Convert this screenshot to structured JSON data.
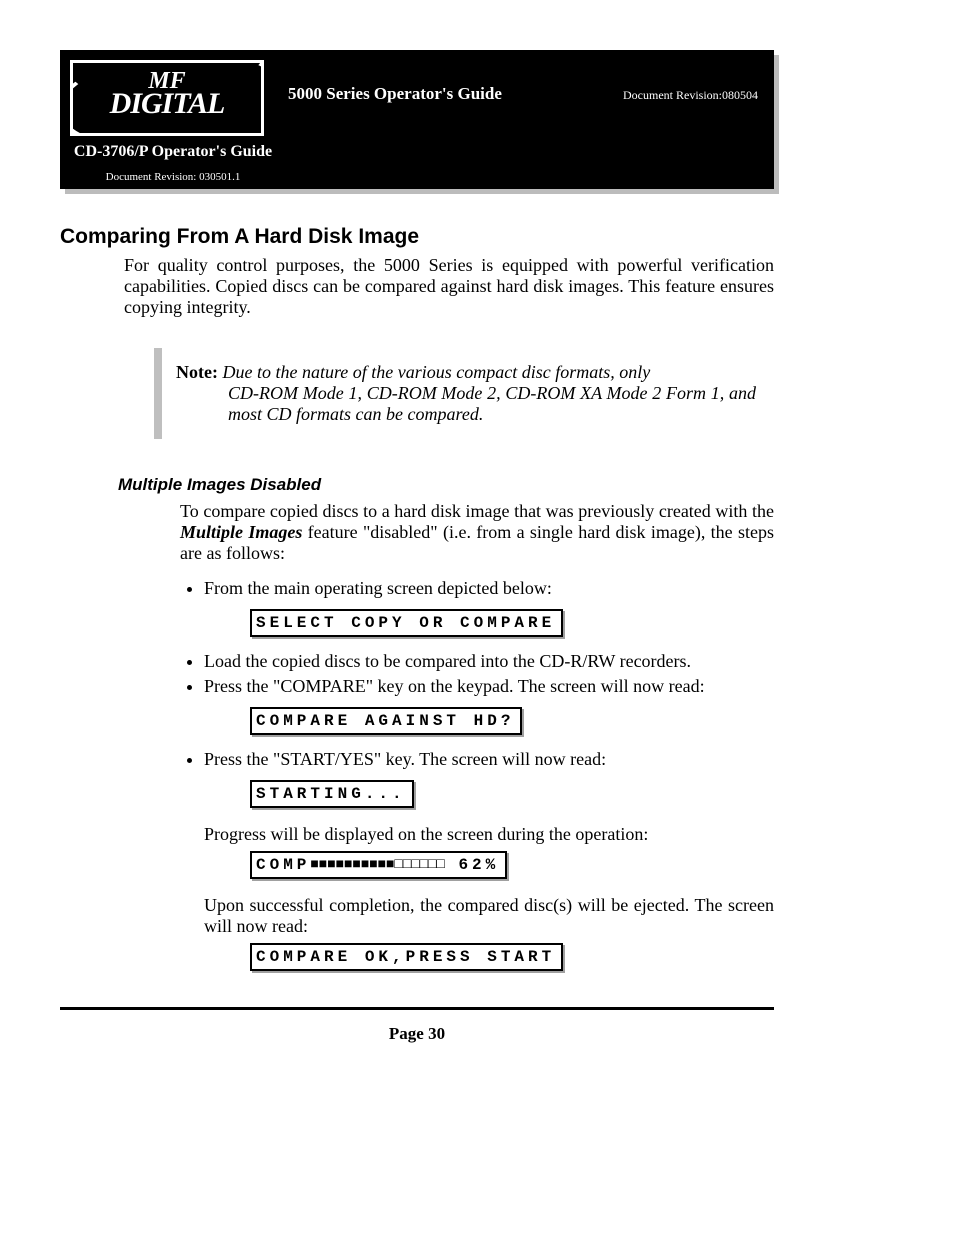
{
  "banner": {
    "logo_line1": "MF",
    "logo_line2": "DIGITAL",
    "title": "5000 Series Operator's Guide",
    "doc_rev_right": "Document Revision:080504",
    "sub_title": "CD-3706/P Operator's Guide",
    "sub_rev": "Document Revision: 030501.1"
  },
  "h1": "Comparing From A Hard Disk Image",
  "intro": "For quality control purposes, the 5000 Series is equipped with powerful verification capabilities. Copied discs can be compared against hard disk images. This feature ensures copying integrity.",
  "note": {
    "label": "Note:",
    "line1": "Due to the nature of the various compact disc formats, only",
    "line2": "CD-ROM Mode 1, CD-ROM Mode 2, CD-ROM XA Mode 2 Form 1, and most CD formats can be compared."
  },
  "h2": "Multiple Images Disabled",
  "para2a": "To compare copied discs to a hard disk image that was previously created with the ",
  "para2b": "Multiple Images",
  "para2c": " feature \"disabled\" (i.e. from a single hard disk image), the steps are as follows:",
  "steps": {
    "s1": "From the main operating screen depicted below:",
    "lcd1": "SELECT COPY OR COMPARE",
    "s2": "Load the copied discs to be compared into the CD-R/RW recorders.",
    "s3": "Press the \"COMPARE\" key on the keypad. The screen will now read:",
    "lcd2": "COMPARE AGAINST HD?",
    "s4": "Press the \"START/YES\" key. The screen will now read:",
    "lcd3": "STARTING...",
    "p_progress": "Progress will be displayed on the screen during the operation:",
    "lcd4_label": "COMP",
    "lcd4_filled": "■■■■■■■■■■",
    "lcd4_empty": "□□□□□□",
    "lcd4_pct": " 62%",
    "p_done": "Upon successful completion, the compared disc(s) will be ejected. The screen will now read:",
    "lcd5": "COMPARE OK,PRESS START"
  },
  "page": "Page 30"
}
